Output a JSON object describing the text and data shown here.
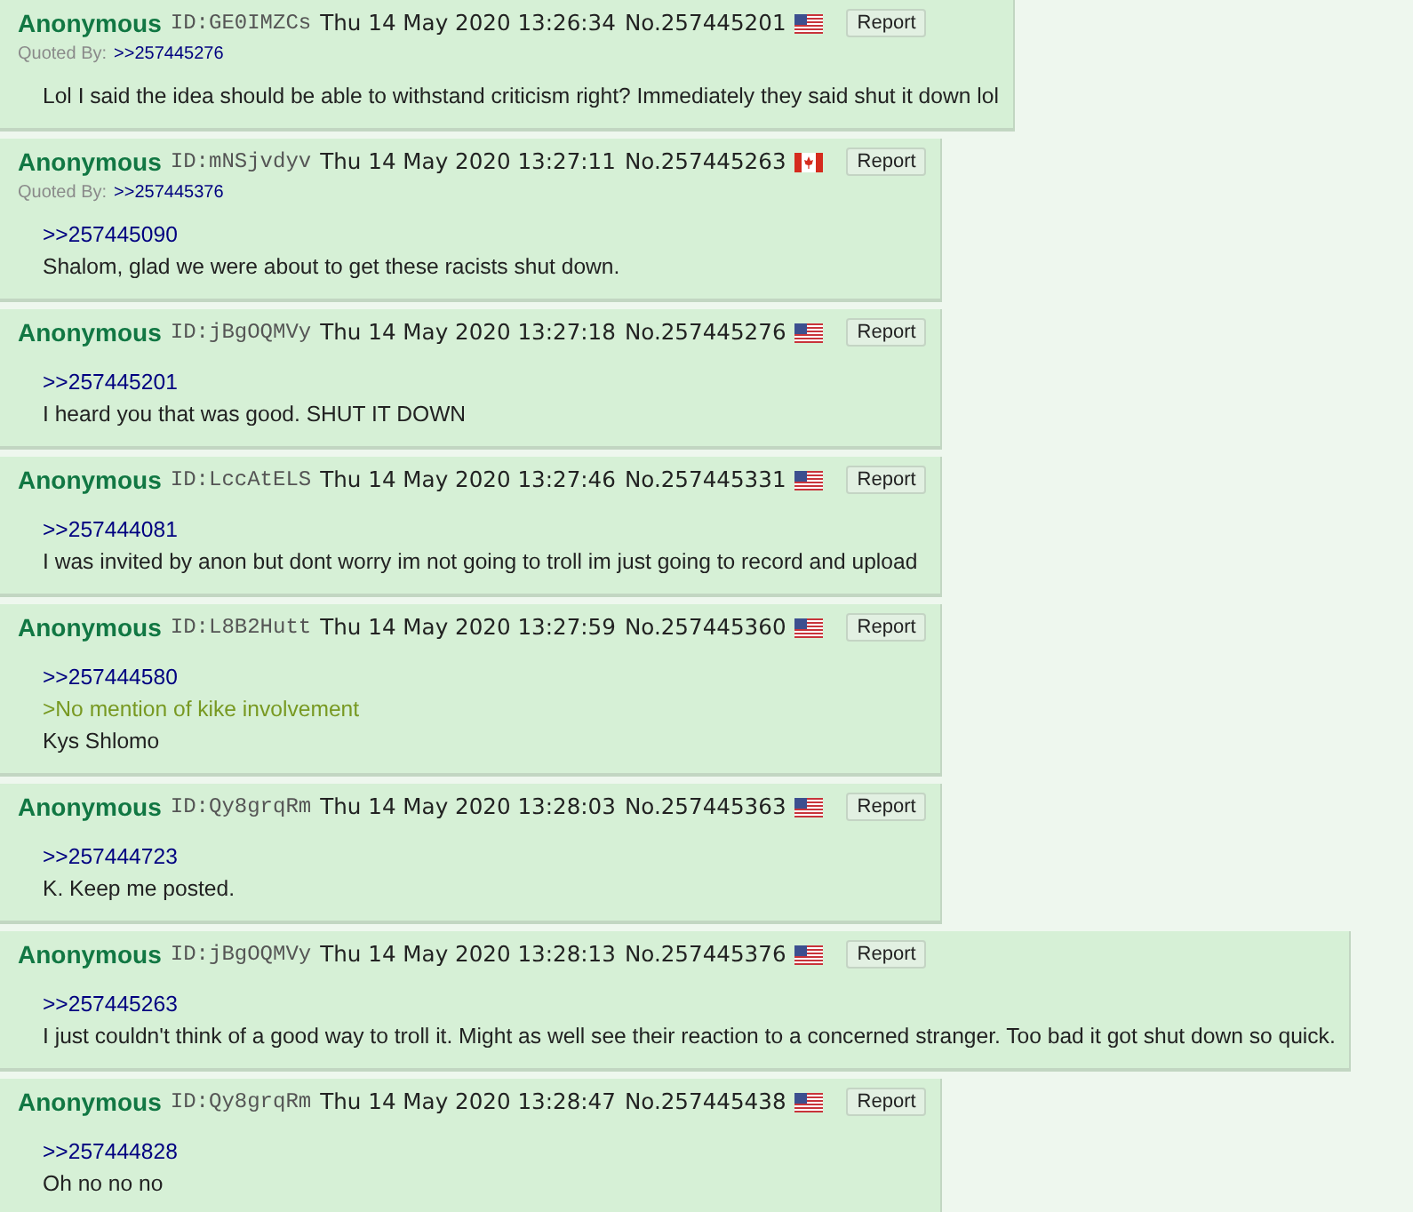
{
  "posts": [
    {
      "name": "Anonymous",
      "id": "ID:GE0IMZCs",
      "datetime": "Thu 14 May 2020 13:26:34",
      "number": "No.257445201",
      "flag": {
        "kind": "us"
      },
      "report": "Report",
      "quoted_by_label": "Quoted By:",
      "quoted_by": [
        ">>257445276"
      ],
      "lines": [
        {
          "kind": "text",
          "text": "Lol I said the idea should be able to withstand criticism right? Immediately they said shut it down lol"
        }
      ]
    },
    {
      "name": "Anonymous",
      "id": "ID:mNSjvdyv",
      "datetime": "Thu 14 May 2020 13:27:11",
      "number": "No.257445263",
      "flag": {
        "kind": "ca"
      },
      "report": "Report",
      "quoted_by_label": "Quoted By:",
      "quoted_by": [
        ">>257445376"
      ],
      "lines": [
        {
          "kind": "quotelink",
          "text": ">>257445090"
        },
        {
          "kind": "text",
          "text": "Shalom, glad we were about to get these racists shut down."
        }
      ]
    },
    {
      "name": "Anonymous",
      "id": "ID:jBgOQMVy",
      "datetime": "Thu 14 May 2020 13:27:18",
      "number": "No.257445276",
      "flag": {
        "kind": "us"
      },
      "report": "Report",
      "lines": [
        {
          "kind": "quotelink",
          "text": ">>257445201"
        },
        {
          "kind": "text",
          "text": "I heard you that was good. SHUT IT DOWN"
        }
      ]
    },
    {
      "name": "Anonymous",
      "id": "ID:LccAtELS",
      "datetime": "Thu 14 May 2020 13:27:46",
      "number": "No.257445331",
      "flag": {
        "kind": "us"
      },
      "report": "Report",
      "lines": [
        {
          "kind": "quotelink",
          "text": ">>257444081"
        },
        {
          "kind": "text",
          "text": "I was invited by anon but dont worry im not going to troll im just going to record and upload"
        }
      ]
    },
    {
      "name": "Anonymous",
      "id": "ID:L8B2Hutt",
      "datetime": "Thu 14 May 2020 13:27:59",
      "number": "No.257445360",
      "flag": {
        "kind": "us"
      },
      "report": "Report",
      "lines": [
        {
          "kind": "quotelink",
          "text": ">>257444580"
        },
        {
          "kind": "greentext",
          "text": ">No mention of kike involvement"
        },
        {
          "kind": "text",
          "text": "Kys Shlomo"
        }
      ]
    },
    {
      "name": "Anonymous",
      "id": "ID:Qy8grqRm",
      "datetime": "Thu 14 May 2020 13:28:03",
      "number": "No.257445363",
      "flag": {
        "kind": "us"
      },
      "report": "Report",
      "lines": [
        {
          "kind": "quotelink",
          "text": ">>257444723"
        },
        {
          "kind": "text",
          "text": "K. Keep me posted."
        }
      ]
    },
    {
      "name": "Anonymous",
      "id": "ID:jBgOQMVy",
      "datetime": "Thu 14 May 2020 13:28:13",
      "number": "No.257445376",
      "flag": {
        "kind": "us"
      },
      "report": "Report",
      "lines": [
        {
          "kind": "quotelink",
          "text": ">>257445263"
        },
        {
          "kind": "text",
          "text": "I just couldn't think of a good way to troll it. Might as well see their reaction to a concerned stranger. Too bad it got shut down so quick."
        }
      ]
    },
    {
      "name": "Anonymous",
      "id": "ID:Qy8grqRm",
      "datetime": "Thu 14 May 2020 13:28:47",
      "number": "No.257445438",
      "flag": {
        "kind": "us"
      },
      "report": "Report",
      "lines": [
        {
          "kind": "quotelink",
          "text": ">>257444828"
        },
        {
          "kind": "text",
          "text": "Oh no no no"
        }
      ]
    }
  ]
}
